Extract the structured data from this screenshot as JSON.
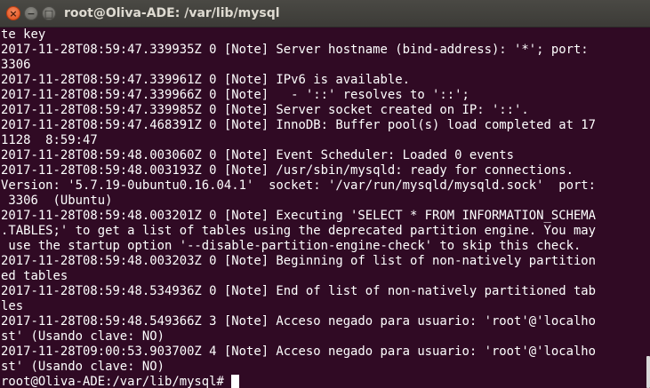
{
  "window": {
    "title": "root@Oliva-ADE: /var/lib/mysql",
    "close_glyph": "×",
    "minimize_glyph": "−",
    "maximize_glyph": "□"
  },
  "terminal": {
    "lines": [
      "te key",
      "2017-11-28T08:59:47.339935Z 0 [Note] Server hostname (bind-address): '*'; port:",
      "3306",
      "2017-11-28T08:59:47.339961Z 0 [Note] IPv6 is available.",
      "2017-11-28T08:59:47.339966Z 0 [Note]   - '::' resolves to '::';",
      "2017-11-28T08:59:47.339985Z 0 [Note] Server socket created on IP: '::'.",
      "2017-11-28T08:59:47.468391Z 0 [Note] InnoDB: Buffer pool(s) load completed at 17",
      "1128  8:59:47",
      "2017-11-28T08:59:48.003060Z 0 [Note] Event Scheduler: Loaded 0 events",
      "2017-11-28T08:59:48.003193Z 0 [Note] /usr/sbin/mysqld: ready for connections.",
      "Version: '5.7.19-0ubuntu0.16.04.1'  socket: '/var/run/mysqld/mysqld.sock'  port:",
      " 3306  (Ubuntu)",
      "2017-11-28T08:59:48.003201Z 0 [Note] Executing 'SELECT * FROM INFORMATION_SCHEMA",
      ".TABLES;' to get a list of tables using the deprecated partition engine. You may",
      " use the startup option '--disable-partition-engine-check' to skip this check.",
      "2017-11-28T08:59:48.003203Z 0 [Note] Beginning of list of non-natively partition",
      "ed tables",
      "2017-11-28T08:59:48.534936Z 0 [Note] End of list of non-natively partitioned tab",
      "les",
      "2017-11-28T08:59:48.549366Z 3 [Note] Acceso negado para usuario: 'root'@'localho",
      "st' (Usando clave: NO)",
      "2017-11-28T09:00:53.903700Z 4 [Note] Acceso negado para usuario: 'root'@'localho",
      "st' (Usando clave: NO)"
    ],
    "prompt": "root@Oliva-ADE:/var/lib/mysql# "
  },
  "colors": {
    "terminal_background": "#300a24",
    "terminal_foreground": "#ffffff",
    "close_button": "#df4b16",
    "titlebar": "#3c3b37"
  }
}
